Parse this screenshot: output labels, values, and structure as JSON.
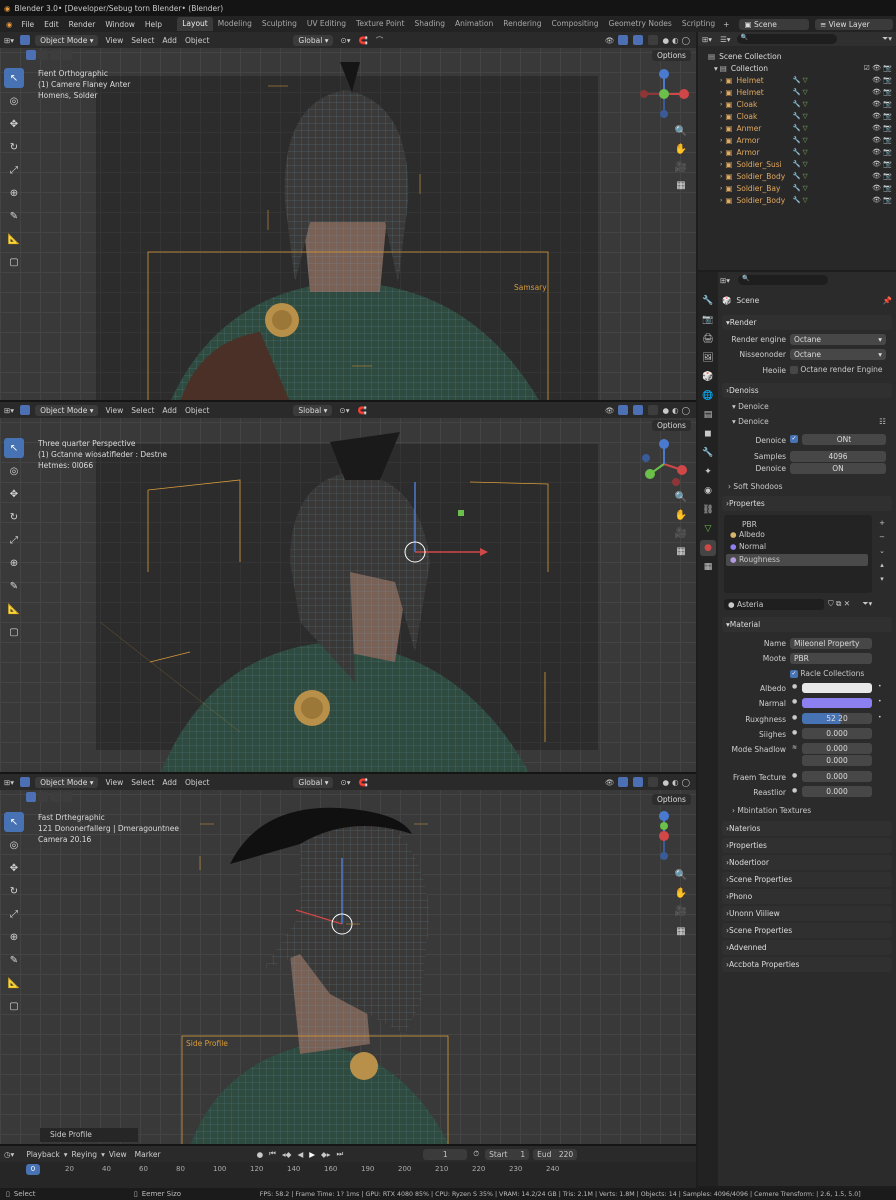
{
  "window": {
    "title": "Blender 3.0• [Developer/Sebug torn Blender• (Blender)"
  },
  "menu": [
    "File",
    "Edit",
    "Render",
    "Window",
    "Help"
  ],
  "workspaces": [
    "Layout",
    "Modeling",
    "Sculpting",
    "UV Editing",
    "Texture Point",
    "Shading",
    "Animation",
    "Rendering",
    "Compositing",
    "Geometry Nodes",
    "Scripting"
  ],
  "scene_selector": "Scene",
  "view_layer_selector": "View Layer",
  "viewport_header": {
    "mode": "Object Mode",
    "menus": [
      "View",
      "Select",
      "Add",
      "Object"
    ],
    "transform": "Global"
  },
  "viewports": [
    {
      "lines": [
        "Fient Orthographic",
        "(1) Camere Flaney Anter",
        "Homens, Solder"
      ],
      "transform": "Global",
      "camera_label": "Samsary",
      "options": "Options"
    },
    {
      "lines": [
        "Three quarter Perspective",
        "(1) Gctanne wiosatifleder : Destne",
        "Hetmes: 0l066"
      ],
      "transform": "Slobal",
      "options": "Options"
    },
    {
      "lines": [
        "Fast Drthegraphic",
        "121 Dononerfallerg | Dmeragountnee",
        "Camera  20.16"
      ],
      "transform": "Global",
      "camera_label": "Side Profile",
      "overlay": "Side Profile",
      "options": "Options"
    }
  ],
  "outliner": {
    "root": "Scene Collection",
    "collection": "Collection",
    "items": [
      "Helmet",
      "Helmet",
      "Cloak",
      "Cloak",
      "Anmer",
      "Armor",
      "Armor",
      "Soldier_Susi",
      "Soldier_Body",
      "Soldier_Bay",
      "Soldier_Body"
    ]
  },
  "properties": {
    "search_placeholder": "",
    "scene": "Scene",
    "render": {
      "title": "Render",
      "engine_label": "Render engine",
      "engine": "Octane",
      "device_label": "Nisseonoder",
      "device": "Octane",
      "check_label": "Heoiie",
      "check_text": "Octane render Engine"
    },
    "denoise": {
      "title": "Denoiss",
      "sub1": "Denoice",
      "sub2": "Denoice",
      "row1_label": "Denoice",
      "row1_value": "ONt",
      "samples_label": "Samples",
      "samples": "4096",
      "row3_label": "Denoice",
      "row3_value": "ON",
      "soft": "Soft Shodoos"
    },
    "properties_title": "Propertes",
    "material_list": [
      "PBR",
      "Albedo",
      "Normal",
      "Roughness"
    ],
    "material_slot": "Asteria",
    "material": {
      "title": "Material",
      "name_label": "Name",
      "name": "Mileonel Property",
      "mode_label": "Moote",
      "mode": "PBR",
      "check": "Racle Collections",
      "albedo_label": "Albedo",
      "normal_label": "Narmal",
      "rough_label": "Ruxghness",
      "rough": "52 20",
      "sights_label": "Siighes",
      "sights": "0.000",
      "mode_shadow_label": "Mode Shadlow",
      "mode_shadow": "0.000",
      "mode_shadow2": "0.000",
      "fresh_label": "Fraem Tecture",
      "fresh": "0.000",
      "resist_label": "Reastlior",
      "resist": "0.000",
      "sub": "Mbintation Textures"
    },
    "panels": [
      "Naterios",
      "Properties",
      "Nodertioor",
      "Scene Properties",
      "Phono",
      "Unonn Viiliew",
      "Scene Properties",
      "Advenned",
      "Accbota Properties"
    ]
  },
  "timeline": {
    "menus": [
      "Playback",
      "Reying",
      "View",
      "Marker"
    ],
    "current": "1",
    "start_label": "Start",
    "start": "1",
    "end_label": "Eud",
    "end": "220",
    "ticks": [
      "0",
      "20",
      "40",
      "60",
      "80",
      "100",
      "120",
      "140",
      "160",
      "190",
      "200",
      "210",
      "220",
      "230",
      "240"
    ]
  },
  "status": {
    "left": "Select",
    "mid": "Eemer Sizo",
    "right": "FPS: 58.2 | Frame Time: 1? 1ms | GPU: RTX 4080 85% | CPU: Ryzen S 35% | VRAM: 14.2/24 GB | Tris: 2.1M | Verts: 1.8M | Objects: 14 | Samples: 4096/4096 | Cemere Trensform: | 2.6, 1.5, 5.0]"
  },
  "colors": {
    "accent": "#4772b3",
    "orange": "#e0a860",
    "albedo": "#e8e8e8",
    "normal": "#8c7ff0"
  }
}
